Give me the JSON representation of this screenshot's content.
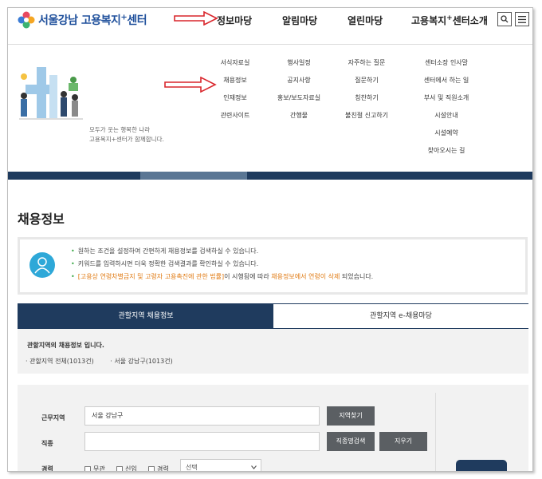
{
  "logo": {
    "text": "서울강남 고용복지",
    "sup": "+",
    "suffix": "센터"
  },
  "gnb": [
    {
      "label": "정보마당",
      "sup": "",
      "suffix": ""
    },
    {
      "label": "알림마당",
      "sup": "",
      "suffix": ""
    },
    {
      "label": "열린마당",
      "sup": "",
      "suffix": ""
    },
    {
      "label": "고용복지",
      "sup": "+",
      "suffix": "센터소개"
    }
  ],
  "mega_menu": {
    "col1": [
      "서식자료실",
      "채용정보",
      "인재정보",
      "관련사이트"
    ],
    "col2": [
      "행사일정",
      "공지사항",
      "홍보/보도자료실",
      "간행물"
    ],
    "col3": [
      "자주하는 질문",
      "질문하기",
      "칭찬하기",
      "불친절 신고하기"
    ],
    "col4": [
      "센터소장 인사말",
      "센터에서 하는 일",
      "부서 및 직원소개",
      "시설안내",
      "시설예약",
      "찾아오시는 길"
    ],
    "promo_line1": "모두가 웃는 행복한 나라",
    "promo_line2": "고용복지+센터가 함께합니다."
  },
  "page_title": "채용정보",
  "info": {
    "line1": "원하는 조건을 설정하여 간편하게 채용정보를 검색하실 수 있습니다.",
    "line2": "키워드를 입력하시면 더욱 정확한 검색결과를 확인하실 수 있습니다.",
    "line3_a": "[고용상 연령차별금지 및 고령자 고용촉진에 관한 법률]",
    "line3_b": "이 시행됨에 따라 ",
    "line3_c": "채용정보에서 연령이 삭제",
    "line3_d": " 되었습니다."
  },
  "tabs": {
    "active": "관할지역 채용정보",
    "inactive": "관할지역 e-채용마당"
  },
  "area": {
    "title": "관할지역의 채용정보 입니다.",
    "links": [
      "· 관할지역 전체(1013건)",
      "· 서울 강남구(1013건)"
    ]
  },
  "search": {
    "region_label": "근무지역",
    "region_value": "서울 강남구",
    "region_btn": "지역찾기",
    "job_label": "직종",
    "job_value": "",
    "job_btn": "직종명검색",
    "clear_btn": "지우기",
    "career_label": "경력",
    "career_options": [
      "무관",
      "신입",
      "경력"
    ],
    "career_select": "선택"
  },
  "colors": {
    "navy": "#1f3b5e",
    "annotation_arrow": "#d9262c",
    "accent_green": "#39a845",
    "accent_orange": "#e07a12"
  }
}
